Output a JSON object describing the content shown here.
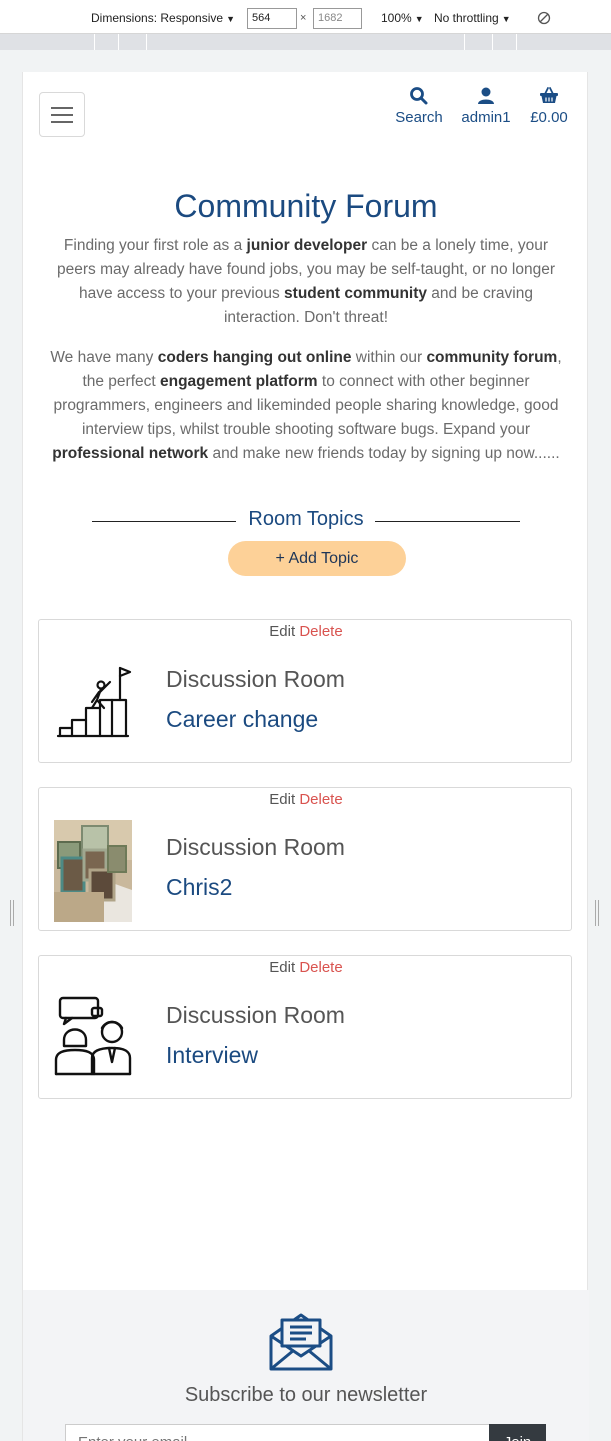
{
  "devtools": {
    "dimensions_label": "Dimensions: Responsive",
    "width_value": "564",
    "height_value": "1682",
    "times": "×",
    "zoom": "100%",
    "throttling": "No throttling"
  },
  "nav": {
    "search_label": "Search",
    "user_label": "admin1",
    "cart_label": "£0.00"
  },
  "hero": {
    "title": "Community Forum",
    "p1": [
      {
        "t": "Finding your first role as a "
      },
      {
        "t": "junior developer",
        "b": true
      },
      {
        "t": " can be a lonely time, your peers may already have found jobs, you may be self-taught, or no longer have access to your previous "
      },
      {
        "t": "student community",
        "b": true
      },
      {
        "t": " and be craving interaction. Don't threat!"
      }
    ],
    "p2": [
      {
        "t": "We have many "
      },
      {
        "t": "coders hanging out online",
        "b": true
      },
      {
        "t": " within our "
      },
      {
        "t": "community forum",
        "b": true
      },
      {
        "t": ", the perfect "
      },
      {
        "t": "engagement platform",
        "b": true
      },
      {
        "t": " to connect with other beginner programmers, engineers and likeminded people sharing knowledge, good interview tips, whilst trouble shooting software bugs. Expand your "
      },
      {
        "t": "professional network",
        "b": true
      },
      {
        "t": " and make new friends today by signing up now......"
      }
    ]
  },
  "topics": {
    "heading": "Room Topics",
    "add_label": "+ Add Topic"
  },
  "rooms": [
    {
      "edit": "Edit",
      "delete": "Delete",
      "kind": "Discussion Room",
      "name": "Career change",
      "icon": "career-climb-icon"
    },
    {
      "edit": "Edit",
      "delete": "Delete",
      "kind": "Discussion Room",
      "name": "Chris2",
      "icon": "photo-frames-image"
    },
    {
      "edit": "Edit",
      "delete": "Delete",
      "kind": "Discussion Room",
      "name": "Interview",
      "icon": "interview-people-icon"
    }
  ],
  "footer": {
    "subscribe_text": "Subscribe to our newsletter",
    "email_placeholder": "Enter your email",
    "join_label": "Join"
  },
  "colors": {
    "brand_blue": "#1b4a80",
    "add_topic_bg": "#fdd198",
    "delete_red": "#d9534f",
    "join_bg": "#343a40"
  }
}
